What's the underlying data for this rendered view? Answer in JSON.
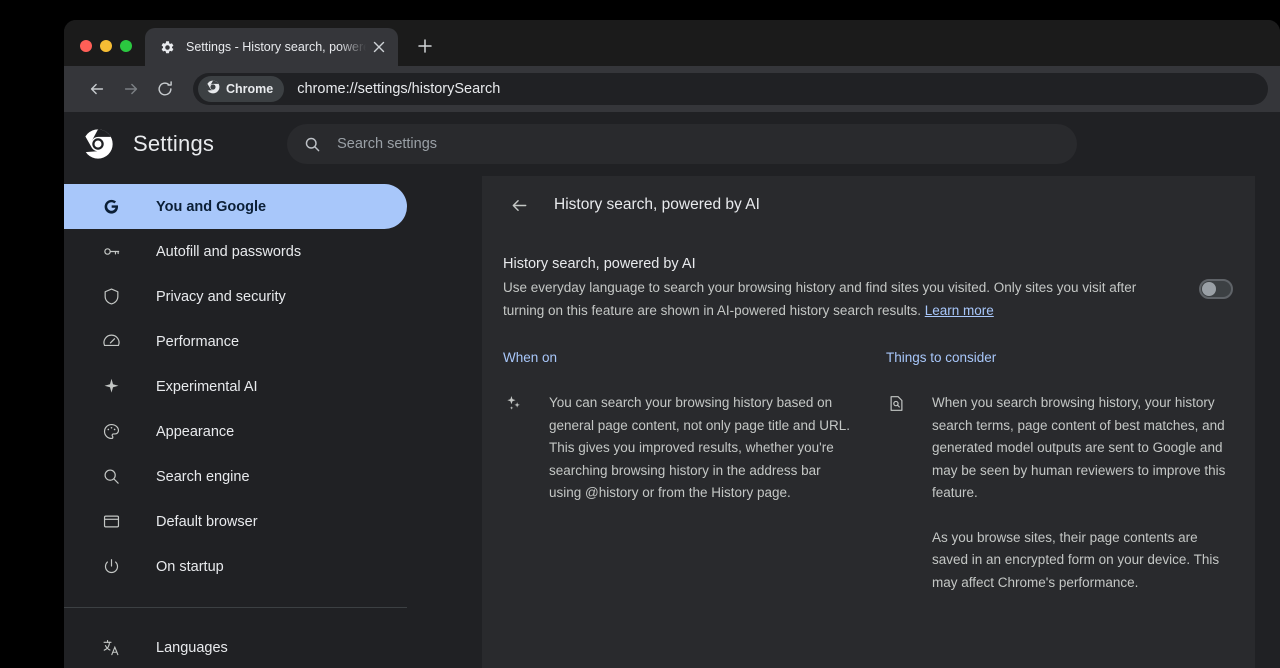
{
  "window": {
    "traffic_lights": [
      "close",
      "minimize",
      "maximize"
    ],
    "tab": {
      "title": "Settings - History search, powered by AI",
      "favicon": "gear-icon",
      "close_label": "×"
    },
    "new_tab_label": "+"
  },
  "toolbar": {
    "back_label": "←",
    "forward_label": "→",
    "reload_label": "⟳",
    "origin_chip": "Chrome",
    "url": "chrome://settings/historySearch"
  },
  "settings": {
    "title": "Settings",
    "search": {
      "placeholder": "Search settings",
      "value": "Search settings"
    }
  },
  "sidebar": {
    "items": [
      {
        "label": "You and Google",
        "icon": "google-g-icon",
        "selected": true
      },
      {
        "label": "Autofill and passwords",
        "icon": "key-icon",
        "selected": false
      },
      {
        "label": "Privacy and security",
        "icon": "shield-icon",
        "selected": false
      },
      {
        "label": "Performance",
        "icon": "speedometer-icon",
        "selected": false
      },
      {
        "label": "Experimental AI",
        "icon": "sparkle-icon",
        "selected": false
      },
      {
        "label": "Appearance",
        "icon": "palette-icon",
        "selected": false
      },
      {
        "label": "Search engine",
        "icon": "magnifier-icon",
        "selected": false
      },
      {
        "label": "Default browser",
        "icon": "browser-window-icon",
        "selected": false
      },
      {
        "label": "On startup",
        "icon": "power-icon",
        "selected": false
      }
    ],
    "items_after_divider": [
      {
        "label": "Languages",
        "icon": "translate-icon",
        "selected": false
      }
    ]
  },
  "subpage": {
    "title": "History search, powered by AI",
    "back_label": "←",
    "setting": {
      "label": "History search, powered by AI",
      "description": "Use everyday language to search your browsing history and find sites you visited. Only sites you visit after turning on this feature are shown in AI-powered history search results.",
      "learn_more": "Learn more",
      "toggle_state": "off"
    },
    "columns": [
      {
        "title": "When on",
        "icon": "sparkle-icon",
        "paragraphs": [
          "You can search your browsing history based on general page content, not only page title and URL. This gives you improved results, whether you're searching browsing history in the address bar using @history or from the History page."
        ]
      },
      {
        "title": "Things to consider",
        "icon": "document-search-icon",
        "paragraphs": [
          "When you search browsing history, your history search terms, page content of best matches, and generated model outputs are sent to Google and may be seen by human reviewers to improve this feature.",
          "As you browse sites, their page contents are saved in an encrypted form on your device. This may affect Chrome's performance."
        ]
      }
    ]
  },
  "colors": {
    "page_background": "#202124",
    "card_background": "#292a2d",
    "accent_blue": "#a8c7fa",
    "text_primary": "#e8eaed",
    "text_secondary": "#c4c7c5"
  }
}
